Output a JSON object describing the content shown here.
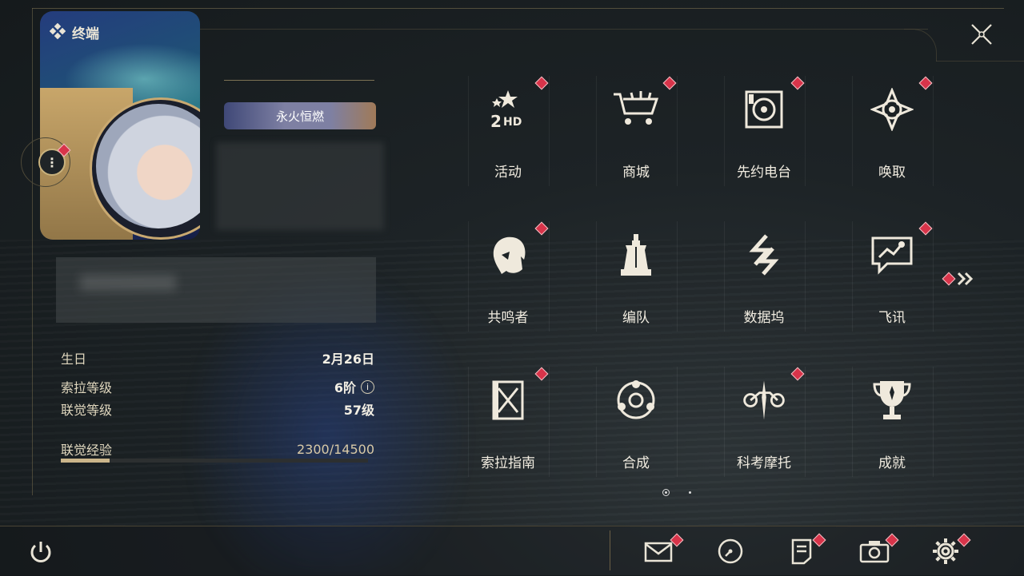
{
  "header": {
    "title": "终端"
  },
  "profile": {
    "title_badge": "永火恒燃",
    "stats": [
      {
        "label": "生日",
        "value": "2月26日"
      },
      {
        "label": "索拉等级",
        "value": "6阶"
      },
      {
        "label": "联觉等级",
        "value": "57级"
      },
      {
        "label": "联觉经验",
        "value": "2300/14500"
      }
    ],
    "xp_current": 2300,
    "xp_max": 14500
  },
  "menu": {
    "items": [
      {
        "label": "活动",
        "icon": "event-icon",
        "badge": true
      },
      {
        "label": "商城",
        "icon": "shop-icon",
        "badge": true
      },
      {
        "label": "先约电台",
        "icon": "radio-icon",
        "badge": true
      },
      {
        "label": "唤取",
        "icon": "convene-icon",
        "badge": true
      },
      {
        "label": "共鸣者",
        "icon": "resonator-icon",
        "badge": true
      },
      {
        "label": "编队",
        "icon": "team-icon",
        "badge": false
      },
      {
        "label": "数据坞",
        "icon": "databank-icon",
        "badge": false
      },
      {
        "label": "飞讯",
        "icon": "chat-icon",
        "badge": true
      },
      {
        "label": "索拉指南",
        "icon": "guidebook-icon",
        "badge": true
      },
      {
        "label": "合成",
        "icon": "synthesis-icon",
        "badge": false
      },
      {
        "label": "科考摩托",
        "icon": "motorcycle-icon",
        "badge": true
      },
      {
        "label": "成就",
        "icon": "trophy-icon",
        "badge": false
      }
    ],
    "page": 1,
    "pages": 2
  },
  "colors": {
    "accent": "#c9b27d",
    "badge": "#d8344a",
    "text": "#f1ece0"
  }
}
